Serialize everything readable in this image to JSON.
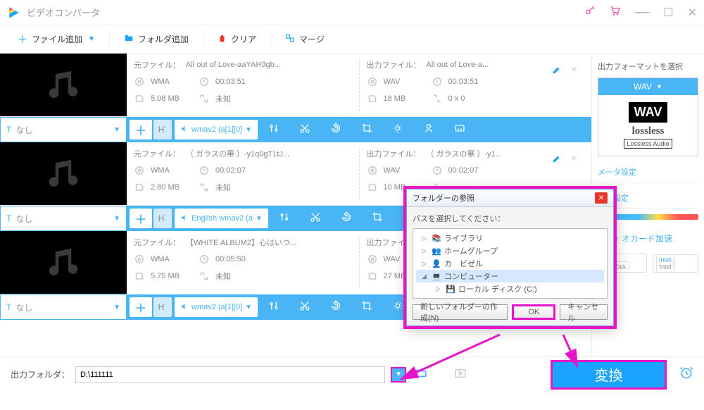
{
  "app": {
    "title": "ビデオコンバータ"
  },
  "toolbar": {
    "add_file": "ファイル追加",
    "add_folder": "フォルダ追加",
    "clear": "クリア",
    "merge": "マージ"
  },
  "items": [
    {
      "src_label": "元ファイル：",
      "src_name": "All out of Love-aaYAH3gb...",
      "src_codec": "WMA",
      "src_dur": "00:03:51",
      "src_size": "5.08 MB",
      "src_res": "未知",
      "out_label": "出力ファイル：",
      "out_name": "All out of Love-a...",
      "out_codec": "WAV",
      "out_dur": "00:03:51",
      "out_size": "18 MB",
      "out_res": "0 x 0",
      "ab_text": "なし",
      "ab_audio": "wmav2 (a[1][0]"
    },
    {
      "src_label": "元ファイル：",
      "src_name": "（ ガラスの華 ）-y1q0gT1tJ...",
      "src_codec": "WMA",
      "src_dur": "00:02:07",
      "src_size": "2.80 MB",
      "src_res": "未知",
      "out_label": "出力ファイル：",
      "out_name": "（ ガラスの華 ）-y1...",
      "out_codec": "WAV",
      "out_dur": "00:02:07",
      "out_size": "10 MB",
      "out_res": "",
      "ab_text": "なし",
      "ab_audio": "English wmav2 (a"
    },
    {
      "src_label": "元ファイル：",
      "src_name": "【WHITE ALBUM2】心はいつ...",
      "src_codec": "WMA",
      "src_dur": "00:05:50",
      "src_size": "5.75 MB",
      "src_res": "未知",
      "out_label": "出力ファイ",
      "out_name": "",
      "out_codec": "WAV",
      "out_dur": "",
      "out_size": "27 MB",
      "out_res": "",
      "ab_text": "なし",
      "ab_audio": "wmav2 (a[1][0]"
    }
  ],
  "sidebar": {
    "title": "出力フォーマットを選択",
    "fmt_head": "WAV",
    "fmt_badge": "WAV",
    "fmt_brand": "lossless",
    "fmt_sub": "Lossless Audio",
    "link_param": "メータ設定",
    "link_task": "ック設定",
    "hw_label": "オカード加速",
    "hw_nvidia": "NVIDIA",
    "hw_intel": "Intel"
  },
  "bottom": {
    "out_label": "出力フォルダ：",
    "out_path": "D:\\111111",
    "convert": "変換"
  },
  "dialog": {
    "title": "フォルダーの参照",
    "prompt": "パスを選択してください：",
    "tree": [
      "ライブラリ",
      "ホームグループ",
      "カ　ビゼル",
      "コンピューター",
      "ローカル ディスク (C:)"
    ],
    "new_folder": "新しいフォルダーの作成(N)",
    "ok": "OK",
    "cancel": "キャンセル"
  }
}
